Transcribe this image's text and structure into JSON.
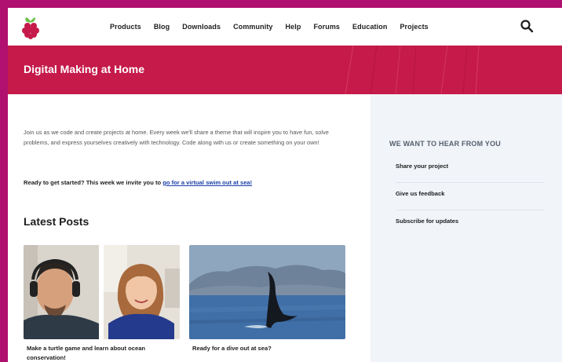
{
  "header": {
    "logo": "raspberry-logo",
    "nav": [
      "Products",
      "Blog",
      "Downloads",
      "Community",
      "Help",
      "Forums",
      "Education",
      "Projects"
    ],
    "search_icon": "search-icon"
  },
  "banner": {
    "title": "Digital Making at Home",
    "color": "#c51a4a"
  },
  "main": {
    "intro": "Join us as we code and create projects at home. Every week we'll share a theme that will inspire you to have fun, solve problems, and express yourselves creatively with technology. Code along with us or create something on your own!",
    "cta_text": "Ready to get started? This week we invite you to ",
    "cta_link": "go for a virtual swim out at sea!",
    "latest_heading": "Latest Posts",
    "posts": [
      {
        "title": "Make a turtle game and learn about ocean conservation!"
      },
      {
        "title": "Ready for a dive out at sea?"
      }
    ]
  },
  "sidebar": {
    "heading": "WE WANT TO HEAR FROM YOU",
    "items": [
      "Share your project",
      "Give us feedback",
      "Subscribe for updates"
    ]
  }
}
